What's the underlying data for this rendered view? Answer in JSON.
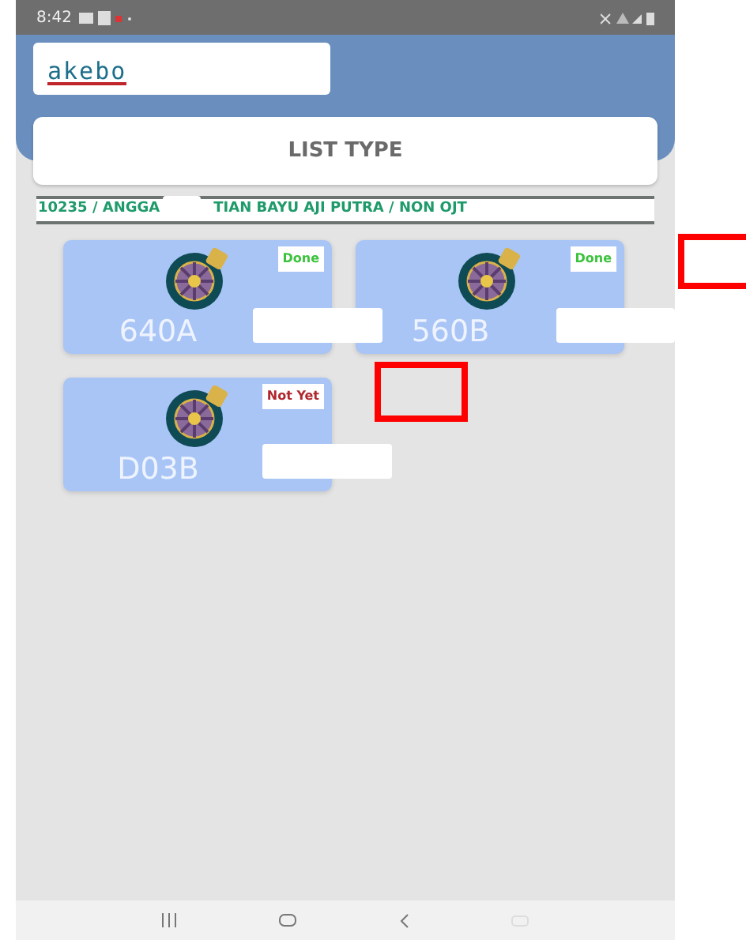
{
  "status_bar": {
    "time": "8:42"
  },
  "header": {
    "logo": "akebo"
  },
  "page_title": "LIST TYPE",
  "operator": {
    "part_1": "10235 / ANGGA",
    "part_2": "TIAN BAYU AJI PUTRA / NON OJT"
  },
  "items": [
    {
      "code": "640A",
      "status": "Done",
      "done": true
    },
    {
      "code": "560B",
      "status": "Done",
      "done": true
    },
    {
      "code": "D03B",
      "status": "Not Yet",
      "done": false
    }
  ]
}
